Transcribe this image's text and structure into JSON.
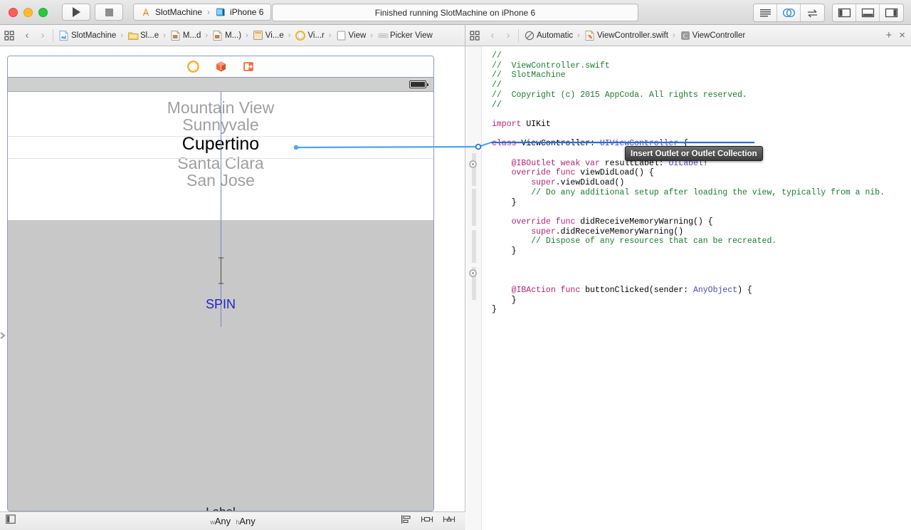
{
  "window": {
    "traffic_lights": [
      "close",
      "minimize",
      "zoom"
    ],
    "run_button": "run",
    "stop_button": "stop",
    "scheme": {
      "project": "SlotMachine",
      "separator": "›",
      "destination": "iPhone 6"
    },
    "status": "Finished running SlotMachine on iPhone 6",
    "right_segments_a": [
      "standard-editor",
      "assistant-editor",
      "version-editor"
    ],
    "right_segments_b": [
      "toggle-navigator",
      "toggle-debug-area",
      "toggle-utilities"
    ]
  },
  "jumpbar_left": {
    "back": "‹",
    "forward": "›",
    "crumbs": [
      {
        "label": "SlotMachine",
        "icon": "storyboard-icon"
      },
      {
        "label": "Sl...e",
        "icon": "folder-icon"
      },
      {
        "label": "M...d",
        "icon": "storyboard-icon"
      },
      {
        "label": "M...)",
        "icon": "storyboard-icon"
      },
      {
        "label": "Vi...e",
        "icon": "view-controller-scene-icon"
      },
      {
        "label": "Vi...r",
        "icon": "view-controller-icon"
      },
      {
        "label": "View",
        "icon": "view-icon"
      },
      {
        "label": "Picker View",
        "icon": "picker-view-icon"
      }
    ]
  },
  "jumpbar_right": {
    "back": "‹",
    "forward": "›",
    "crumbs": [
      {
        "label": "Automatic",
        "icon": "automatic-icon"
      },
      {
        "label": "ViewController.swift",
        "icon": "swift-file-icon"
      },
      {
        "label": "ViewController",
        "icon": "class-icon"
      }
    ],
    "add_button": "+",
    "close_button": "×"
  },
  "canvas": {
    "scene_dock": [
      "view-controller-icon",
      "first-responder-icon",
      "exit-icon"
    ],
    "picker_view": {
      "rows": [
        "Mountain View",
        "Sunnyvale",
        "Cupertino",
        "Santa Clara",
        "San Jose"
      ],
      "selected_index": 2
    },
    "spin_button": "SPIN",
    "label_placeholder": "Label",
    "bottom_bar": {
      "size_class_w_prefix": "w",
      "size_class_w": "Any",
      "size_class_h_prefix": "h",
      "size_class_h": "Any",
      "tools": [
        "align-icon",
        "pin-icon",
        "resolve-auto-layout-icon"
      ]
    }
  },
  "editor": {
    "lines": [
      [
        {
          "t": "//",
          "c": "cmt"
        }
      ],
      [
        {
          "t": "//  ViewController.swift",
          "c": "cmt"
        }
      ],
      [
        {
          "t": "//  SlotMachine",
          "c": "cmt"
        }
      ],
      [
        {
          "t": "//",
          "c": "cmt"
        }
      ],
      [
        {
          "t": "//  Copyright (c) 2015 AppCoda. All rights reserved.",
          "c": "cmt"
        }
      ],
      [
        {
          "t": "//",
          "c": "cmt"
        }
      ],
      [
        {
          "t": "",
          "c": "plain"
        }
      ],
      [
        {
          "t": "import",
          "c": "kw"
        },
        {
          "t": " UIKit",
          "c": "plain"
        }
      ],
      [
        {
          "t": "",
          "c": "plain"
        }
      ],
      [
        {
          "t": "class",
          "c": "kw"
        },
        {
          "t": " ViewController: ",
          "c": "plain"
        },
        {
          "t": "UIViewController",
          "c": "typ"
        },
        {
          "t": " {",
          "c": "plain"
        }
      ],
      [
        {
          "t": "",
          "c": "plain"
        }
      ],
      [
        {
          "t": "    @IBOutlet",
          "c": "attr"
        },
        {
          "t": " ",
          "c": "plain"
        },
        {
          "t": "weak",
          "c": "kw"
        },
        {
          "t": " ",
          "c": "plain"
        },
        {
          "t": "var",
          "c": "kw"
        },
        {
          "t": " resultLabel: ",
          "c": "plain"
        },
        {
          "t": "UILabel",
          "c": "typ"
        },
        {
          "t": "!",
          "c": "plain"
        }
      ],
      [
        {
          "t": "    override",
          "c": "kw"
        },
        {
          "t": " ",
          "c": "plain"
        },
        {
          "t": "func",
          "c": "kw"
        },
        {
          "t": " viewDidLoad() {",
          "c": "plain"
        }
      ],
      [
        {
          "t": "        super",
          "c": "kw"
        },
        {
          "t": ".viewDidLoad()",
          "c": "plain"
        }
      ],
      [
        {
          "t": "        // Do any additional setup after loading the view, typically from a nib.",
          "c": "cmt"
        }
      ],
      [
        {
          "t": "    }",
          "c": "plain"
        }
      ],
      [
        {
          "t": "",
          "c": "plain"
        }
      ],
      [
        {
          "t": "    override",
          "c": "kw"
        },
        {
          "t": " ",
          "c": "plain"
        },
        {
          "t": "func",
          "c": "kw"
        },
        {
          "t": " didReceiveMemoryWarning() {",
          "c": "plain"
        }
      ],
      [
        {
          "t": "        super",
          "c": "kw"
        },
        {
          "t": ".didReceiveMemoryWarning()",
          "c": "plain"
        }
      ],
      [
        {
          "t": "        // Dispose of any resources that can be recreated.",
          "c": "cmt"
        }
      ],
      [
        {
          "t": "    }",
          "c": "plain"
        }
      ],
      [
        {
          "t": "",
          "c": "plain"
        }
      ],
      [
        {
          "t": "",
          "c": "plain"
        }
      ],
      [
        {
          "t": "",
          "c": "plain"
        }
      ],
      [
        {
          "t": "    @IBAction",
          "c": "attr"
        },
        {
          "t": " ",
          "c": "plain"
        },
        {
          "t": "func",
          "c": "kw"
        },
        {
          "t": " buttonClicked(sender: ",
          "c": "plain"
        },
        {
          "t": "AnyObject",
          "c": "typ"
        },
        {
          "t": ") {",
          "c": "plain"
        }
      ],
      [
        {
          "t": "    }",
          "c": "plain"
        }
      ],
      [
        {
          "t": "}",
          "c": "plain"
        }
      ]
    ]
  },
  "tooltip": {
    "text": "Insert Outlet or Outlet Collection"
  },
  "colors": {
    "accent_blue": "#3399ff",
    "spin_blue": "#2222cc",
    "comment_green": "#1c7c31",
    "keyword_pink": "#b02772",
    "type_purple": "#4b49b8",
    "gray_fill": "#c8c8c8"
  }
}
